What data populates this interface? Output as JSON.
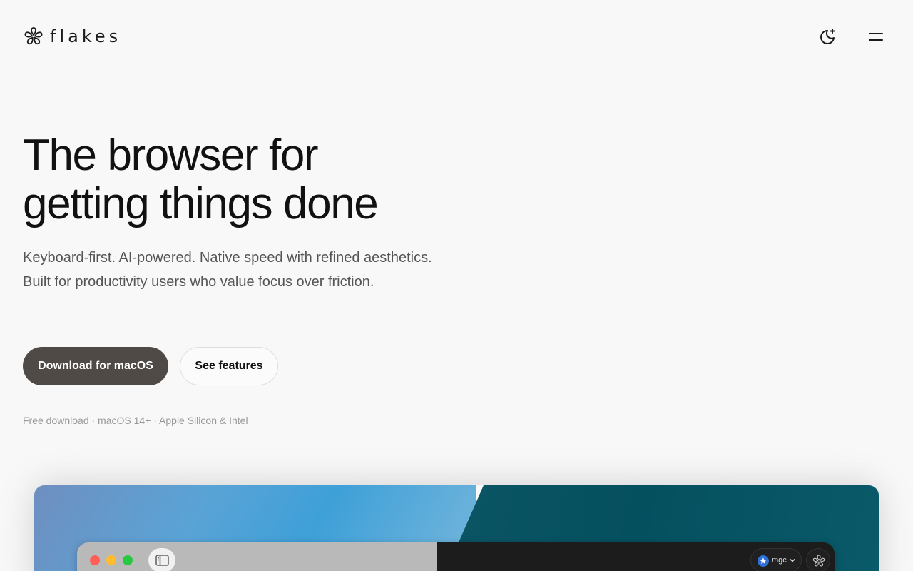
{
  "header": {
    "brand": "flakes",
    "theme_toggle_icon": "moon-sparkle-icon",
    "menu_icon": "hamburger-menu-icon"
  },
  "hero": {
    "title_line1": "The browser for",
    "title_line2": "getting things done",
    "subtitle": "Keyboard-first. AI-powered. Native speed with refined aesthetics. Built for productivity users who value focus over friction.",
    "primary_cta": "Download for macOS",
    "secondary_cta": "See features",
    "footnote": "Free download · macOS 14+ · Apple Silicon & Intel"
  },
  "preview": {
    "profile_name": "mgc",
    "colors": {
      "window_close": "#ff5f57",
      "window_minimize": "#febc2e",
      "window_zoom": "#28c840",
      "primary_button": "#4f4a45"
    }
  }
}
